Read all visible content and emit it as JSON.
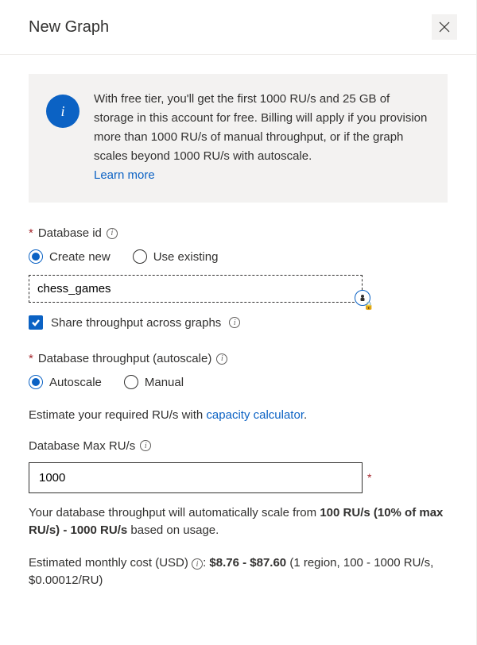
{
  "header": {
    "title": "New Graph"
  },
  "infobox": {
    "text": "With free tier, you'll get the first 1000 RU/s and 25 GB of storage in this account for free. Billing will apply if you provision more than 1000 RU/s of manual throughput, or if the graph scales beyond 1000 RU/s with autoscale.",
    "link": "Learn more"
  },
  "database_id": {
    "label": "Database id",
    "options": {
      "create_new": "Create new",
      "use_existing": "Use existing"
    },
    "selected": "create_new",
    "value": "chess_games"
  },
  "share_throughput": {
    "label": "Share throughput across graphs",
    "checked": true
  },
  "throughput_mode": {
    "label": "Database throughput (autoscale)",
    "options": {
      "autoscale": "Autoscale",
      "manual": "Manual"
    },
    "selected": "autoscale"
  },
  "estimate_line": {
    "prefix": "Estimate your required RU/s with ",
    "link": "capacity calculator",
    "suffix": "."
  },
  "max_ru": {
    "label": "Database Max RU/s",
    "value": "1000"
  },
  "scale_note": {
    "pre": "Your database throughput will automatically scale from ",
    "bold": "100 RU/s (10% of max RU/s) - 1000 RU/s",
    "post": " based on usage."
  },
  "cost": {
    "label": "Estimated monthly cost (USD)",
    "bold": "$8.76 - $87.60",
    "details": " (1 region, 100 - 1000 RU/s, $0.00012/RU)"
  }
}
